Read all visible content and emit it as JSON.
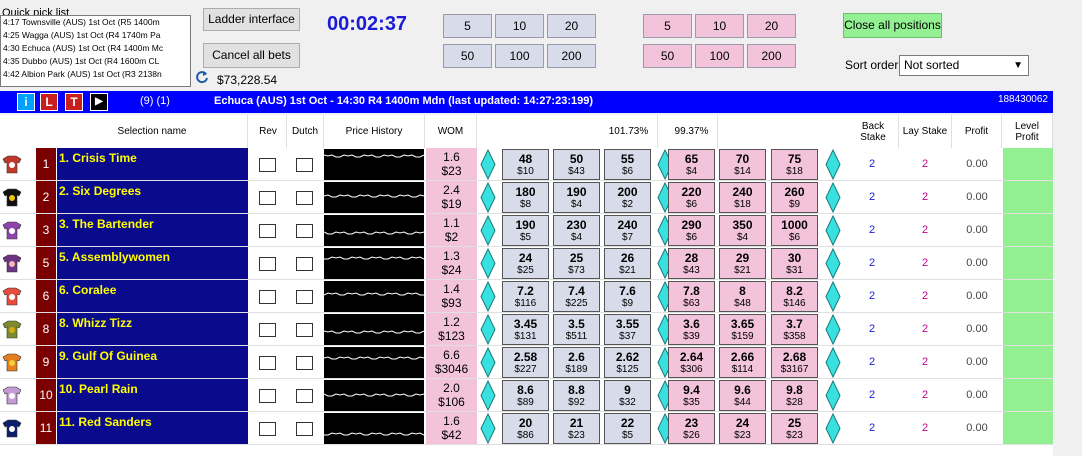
{
  "quick_pick": {
    "title": "Quick pick list",
    "items": [
      "4:17 Townsville (AUS) 1st Oct (R5 1400m",
      "4:25 Wagga (AUS) 1st Oct (R4 1740m Pa",
      "4:30 Echuca (AUS) 1st Oct (R4 1400m Mc",
      "4:35 Dubbo (AUS) 1st Oct (R4 1600m CL",
      "4:42 Albion Park (AUS) 1st Oct (R3 2138n"
    ]
  },
  "buttons": {
    "ladder": "Ladder interface",
    "cancel_all": "Cancel all bets",
    "close_all": "Close all positions"
  },
  "balance": "$73,228.54",
  "timer": "00:02:37",
  "back_stakes": [
    "5",
    "10",
    "20",
    "50",
    "100",
    "200"
  ],
  "lay_stakes": [
    "5",
    "10",
    "20",
    "50",
    "100",
    "200"
  ],
  "sort": {
    "label": "Sort order",
    "value": "Not sorted"
  },
  "market_bar": {
    "btn_i": "i",
    "btn_l": "L",
    "btn_t": "T",
    "count": "(9) (1)",
    "title": "Echuca (AUS) 1st Oct - 14:30 R4 1400m Mdn (last updated: 14:27:23:199)",
    "market_id": "188430062"
  },
  "headers": {
    "selection": "Selection name",
    "rev": "Rev",
    "dutch": "Dutch",
    "price_history": "Price History",
    "wom": "WOM",
    "back_pct": "101.73%",
    "lay_pct": "99.37%",
    "back_stake": "Back Stake",
    "lay_stake": "Lay Stake",
    "profit": "Profit",
    "level_profit": "Level Profit"
  },
  "colors": {
    "blue_bar": "#0000ff",
    "name_bg": "#0a0a8c",
    "name_text": "#ffff00",
    "back": "#d8dcea",
    "lay": "#f3c3dc",
    "level": "#92f092"
  },
  "runners": [
    {
      "num": "1",
      "name": "1. Crisis Time",
      "wom_pct": "1.6",
      "wom_amt": "$23",
      "back": [
        {
          "p": "48",
          "a": "$10"
        },
        {
          "p": "50",
          "a": "$43"
        },
        {
          "p": "55",
          "a": "$6"
        }
      ],
      "lay": [
        {
          "p": "65",
          "a": "$4"
        },
        {
          "p": "70",
          "a": "$14"
        },
        {
          "p": "75",
          "a": "$18"
        }
      ],
      "back_stake": "2",
      "lay_stake": "2",
      "profit": "0.00"
    },
    {
      "num": "2",
      "name": "2. Six Degrees",
      "wom_pct": "2.4",
      "wom_amt": "$19",
      "back": [
        {
          "p": "180",
          "a": "$8"
        },
        {
          "p": "190",
          "a": "$4"
        },
        {
          "p": "200",
          "a": "$2"
        }
      ],
      "lay": [
        {
          "p": "220",
          "a": "$6"
        },
        {
          "p": "240",
          "a": "$18"
        },
        {
          "p": "260",
          "a": "$9"
        }
      ],
      "back_stake": "2",
      "lay_stake": "2",
      "profit": "0.00"
    },
    {
      "num": "3",
      "name": "3. The Bartender",
      "wom_pct": "1.1",
      "wom_amt": "$2",
      "back": [
        {
          "p": "190",
          "a": "$5"
        },
        {
          "p": "230",
          "a": "$4"
        },
        {
          "p": "240",
          "a": "$7"
        }
      ],
      "lay": [
        {
          "p": "290",
          "a": "$6"
        },
        {
          "p": "350",
          "a": "$4"
        },
        {
          "p": "1000",
          "a": "$6"
        }
      ],
      "back_stake": "2",
      "lay_stake": "2",
      "profit": "0.00"
    },
    {
      "num": "5",
      "name": "5. Assemblywomen",
      "wom_pct": "1.3",
      "wom_amt": "$24",
      "back": [
        {
          "p": "24",
          "a": "$25"
        },
        {
          "p": "25",
          "a": "$73"
        },
        {
          "p": "26",
          "a": "$21"
        }
      ],
      "lay": [
        {
          "p": "28",
          "a": "$43"
        },
        {
          "p": "29",
          "a": "$21"
        },
        {
          "p": "30",
          "a": "$31"
        }
      ],
      "back_stake": "2",
      "lay_stake": "2",
      "profit": "0.00"
    },
    {
      "num": "6",
      "name": "6. Coralee",
      "wom_pct": "1.4",
      "wom_amt": "$93",
      "back": [
        {
          "p": "7.2",
          "a": "$116"
        },
        {
          "p": "7.4",
          "a": "$225"
        },
        {
          "p": "7.6",
          "a": "$9"
        }
      ],
      "lay": [
        {
          "p": "7.8",
          "a": "$63"
        },
        {
          "p": "8",
          "a": "$48"
        },
        {
          "p": "8.2",
          "a": "$146"
        }
      ],
      "back_stake": "2",
      "lay_stake": "2",
      "profit": "0.00"
    },
    {
      "num": "8",
      "name": "8. Whizz Tizz",
      "wom_pct": "1.2",
      "wom_amt": "$123",
      "back": [
        {
          "p": "3.45",
          "a": "$131"
        },
        {
          "p": "3.5",
          "a": "$511"
        },
        {
          "p": "3.55",
          "a": "$37"
        }
      ],
      "lay": [
        {
          "p": "3.6",
          "a": "$39"
        },
        {
          "p": "3.65",
          "a": "$159"
        },
        {
          "p": "3.7",
          "a": "$358"
        }
      ],
      "back_stake": "2",
      "lay_stake": "2",
      "profit": "0.00"
    },
    {
      "num": "9",
      "name": "9. Gulf Of Guinea",
      "wom_pct": "6.6",
      "wom_amt": "$3046",
      "back": [
        {
          "p": "2.58",
          "a": "$227"
        },
        {
          "p": "2.6",
          "a": "$189"
        },
        {
          "p": "2.62",
          "a": "$125"
        }
      ],
      "lay": [
        {
          "p": "2.64",
          "a": "$306"
        },
        {
          "p": "2.66",
          "a": "$114"
        },
        {
          "p": "2.68",
          "a": "$3167"
        }
      ],
      "back_stake": "2",
      "lay_stake": "2",
      "profit": "0.00"
    },
    {
      "num": "10",
      "name": "10. Pearl Rain",
      "wom_pct": "2.0",
      "wom_amt": "$106",
      "back": [
        {
          "p": "8.6",
          "a": "$89"
        },
        {
          "p": "8.8",
          "a": "$92"
        },
        {
          "p": "9",
          "a": "$32"
        }
      ],
      "lay": [
        {
          "p": "9.4",
          "a": "$35"
        },
        {
          "p": "9.6",
          "a": "$44"
        },
        {
          "p": "9.8",
          "a": "$28"
        }
      ],
      "back_stake": "2",
      "lay_stake": "2",
      "profit": "0.00"
    },
    {
      "num": "11",
      "name": "11. Red Sanders",
      "wom_pct": "1.6",
      "wom_amt": "$42",
      "back": [
        {
          "p": "20",
          "a": "$86"
        },
        {
          "p": "21",
          "a": "$23"
        },
        {
          "p": "22",
          "a": "$5"
        }
      ],
      "lay": [
        {
          "p": "23",
          "a": "$26"
        },
        {
          "p": "24",
          "a": "$23"
        },
        {
          "p": "25",
          "a": "$23"
        }
      ],
      "back_stake": "2",
      "lay_stake": "2",
      "profit": "0.00"
    }
  ]
}
